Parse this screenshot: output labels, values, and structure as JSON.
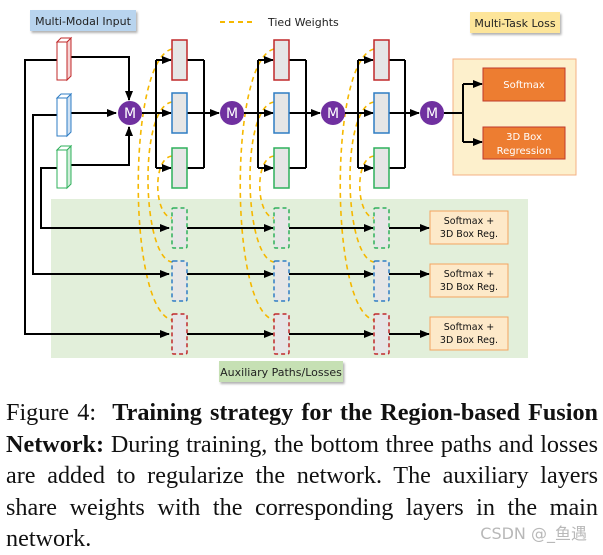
{
  "diagram": {
    "legend": {
      "input_label": "Multi-Modal Input",
      "tied_weights_label": "Tied Weights",
      "multitask_label": "Multi-Task Loss",
      "auxiliary_label": "Auxiliary Paths/Losses"
    },
    "merge_label": "M",
    "merge_nodes": [
      "M",
      "M",
      "M",
      "M"
    ],
    "main_losses": [
      "Softmax",
      "3D Box",
      "Regression"
    ],
    "aux_losses": [
      {
        "line1": "Softmax +",
        "line2": "3D Box Reg."
      },
      {
        "line1": "Softmax +",
        "line2": "3D Box Reg."
      },
      {
        "line1": "Softmax +",
        "line2": "3D Box Reg."
      }
    ],
    "colors": {
      "red": "#c0282a",
      "blue": "#2f7dc4",
      "green": "#2fb05b",
      "merge_purple": "#7030a0",
      "tied_weights": "#f5b800",
      "loss_orange": "#ed7d31",
      "loss_panel": "#fdf0cc",
      "aux_panel": "#e2efda",
      "input_label_bg": "#b8d4ee",
      "multitask_label_bg": "#fde59a",
      "aux_label_bg": "#c6e0b4",
      "layer_fill": "#e6e6e6"
    }
  },
  "caption": {
    "prefix": "Figure 4:",
    "bold": "Training strategy for the Region-based Fusion Network:",
    "body": "During training, the bottom three paths and losses are added to regularize the network. The auxiliary layers share weights with the corresponding layers in the main network."
  },
  "watermark": "CSDN @_鱼遇"
}
